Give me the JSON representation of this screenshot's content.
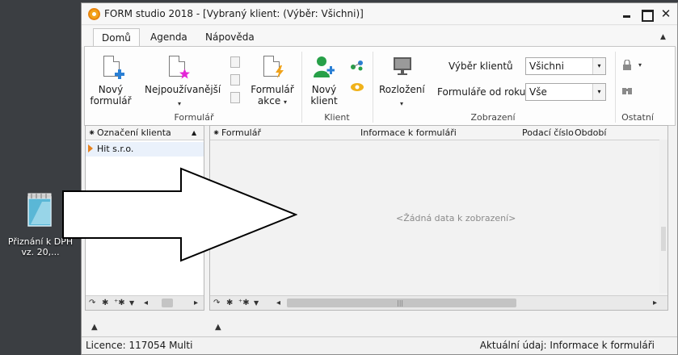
{
  "desktop": {
    "icon_label": "Přiznání k DPH vz. 20,..."
  },
  "window": {
    "title": "FORM studio 2018 - [Vybraný klient:  (Výběr: Všichni)]",
    "min_glyph": "",
    "close_glyph": "✕"
  },
  "tabs": [
    {
      "label": "Domů",
      "active": true
    },
    {
      "label": "Agenda",
      "active": false
    },
    {
      "label": "Nápověda",
      "active": false
    }
  ],
  "ribbon": {
    "collapse_glyph": "▲",
    "formular": {
      "new_label_1": "Nový",
      "new_label_2": "formulář",
      "most_used_label": "Nejpoužívanější",
      "actions_label_1": "Formulář",
      "actions_label_2": "akce",
      "group_label": "Formulář"
    },
    "klient": {
      "new_label_1": "Nový",
      "new_label_2": "klient",
      "group_label": "Klient"
    },
    "zobrazeni": {
      "layout_label": "Rozložení",
      "client_select_label": "Výběr klientů",
      "client_select_value": "Všichni",
      "forms_from_year_label": "Formuláře od roku",
      "forms_from_year_value": "Vše",
      "group_label": "Zobrazení"
    },
    "ostatni": {
      "group_label": "Ostatní"
    },
    "caret": "▾"
  },
  "left_panel": {
    "column_header": "Označení klienta",
    "sort_glyph": "▲",
    "filter_glyph": "⁕",
    "rows": [
      "Hit s.r.o."
    ],
    "footer": {
      "refresh": "↷",
      "asterisk": "✱",
      "asterisk2": "⁺✱",
      "funnel": "▼",
      "left": "◂",
      "right": "▸"
    }
  },
  "right_panel": {
    "filter_glyph": "⁕",
    "columns": [
      "Formulář",
      "Informace k formuláři",
      "Podací číslo",
      "Období"
    ],
    "empty_text": "<Žádná data k zobrazení>",
    "footer": {
      "refresh": "↷",
      "asterisk": "✱",
      "asterisk2": "⁺✱",
      "funnel": "▼",
      "left": "◂",
      "grip": "|||",
      "right": "▸"
    }
  },
  "bottom": {
    "up_arrow": "▲"
  },
  "status": {
    "license": "Licence: 117054 Multi",
    "current": "Aktuální údaj: Informace k formuláři"
  },
  "colors": {
    "accent": "#2a7fd4",
    "orange": "#e7821e",
    "green": "#27a048"
  }
}
